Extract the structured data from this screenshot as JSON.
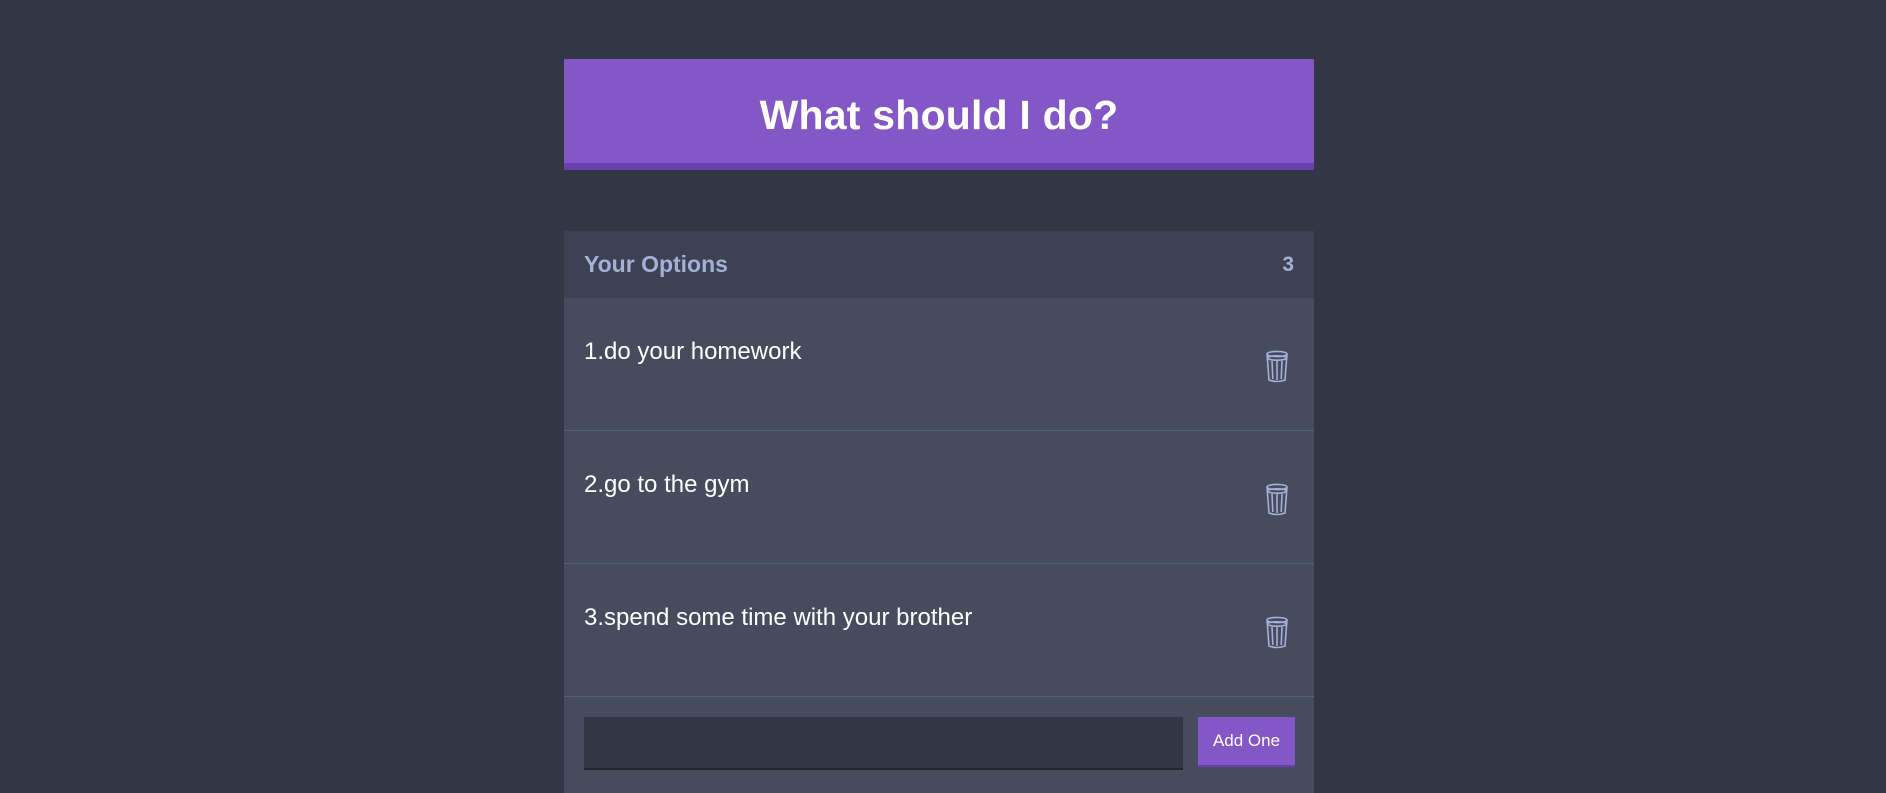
{
  "header": {
    "title": "What should I do?"
  },
  "options_panel": {
    "title": "Your Options",
    "count": "3",
    "items": [
      {
        "label": "1.do your homework",
        "remove_icon": "trash-icon"
      },
      {
        "label": "2.go to the gym",
        "remove_icon": "trash-icon"
      },
      {
        "label": "3.spend some time with your brother",
        "remove_icon": "trash-icon"
      }
    ]
  },
  "add_option": {
    "input_value": "",
    "button_label": "Add One"
  },
  "colors": {
    "background": "#333645",
    "accent": "#8357c5",
    "panel": "#464b5e",
    "panel_header": "#3c4251",
    "muted_text": "#a5afd7"
  }
}
